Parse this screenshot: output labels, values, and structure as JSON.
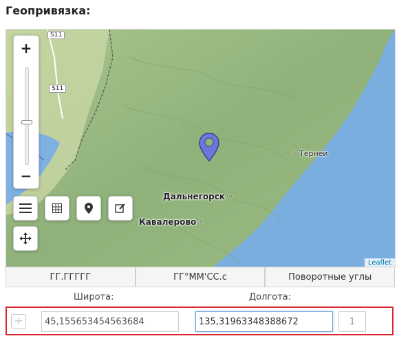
{
  "section_title": "Геопривязка:",
  "map": {
    "zoom_in": "+",
    "zoom_out": "−",
    "road_labels": [
      "S11",
      "S11"
    ],
    "places": {
      "terney": "Терней",
      "dalnegorsk": "Дальнегорск",
      "kavalerovo": "Кавалерово"
    },
    "attribution": "Leaflet",
    "marker_color": "#6f76d9"
  },
  "tabs": [
    {
      "label": "ГГ.ГГГГГ",
      "active": false
    },
    {
      "label": "ГГ°ММ'СС.с",
      "active": false
    },
    {
      "label": "Поворотные углы",
      "active": false
    }
  ],
  "coords": {
    "lat_header": "Широта:",
    "lon_header": "Долгота:",
    "add_label": "+",
    "latitude": "45,155653454563684",
    "longitude": "135,31963348388672",
    "index": "1",
    "highlight_color": "#d9272e"
  }
}
